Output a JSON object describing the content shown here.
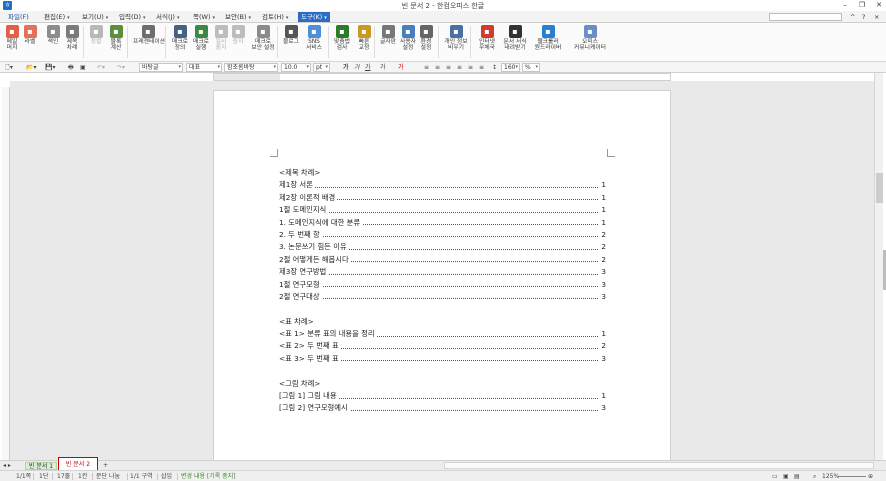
{
  "window": {
    "title": "빈 문서 2 - 한컴오피스 한글",
    "app_icon": "hwp-app-icon",
    "controls": [
      "–",
      "❐",
      "✕"
    ]
  },
  "menubar": {
    "items": [
      {
        "label": "파일(F)"
      },
      {
        "label": "편집(E)"
      },
      {
        "label": "보기(U)"
      },
      {
        "label": "입력(D)"
      },
      {
        "label": "서식(J)"
      },
      {
        "label": "쪽(W)"
      },
      {
        "label": "보안(B)"
      },
      {
        "label": "검토(H)"
      },
      {
        "label": "도구(K)"
      }
    ],
    "active": "도구(K)"
  },
  "ribbon": {
    "buttons": [
      {
        "l1": "메일",
        "l2": "머지",
        "icon": "mail-merge-icon",
        "color": "#e0604a"
      },
      {
        "l1": "라벨",
        "l2": "",
        "icon": "label-icon",
        "color": "#e66f5a"
      },
      {
        "l1": "색인",
        "l2": "",
        "icon": "index-icon",
        "color": "#8c8c8c"
      },
      {
        "l1": "제목",
        "l2": "차례",
        "icon": "toc-icon",
        "color": "#7b7b7b"
      },
      {
        "l1": "정렬",
        "l2": "",
        "icon": "sort-icon",
        "color": "#b8b8b8",
        "dim": true
      },
      {
        "l1": "블록",
        "l2": "계산",
        "icon": "block-calc-icon",
        "color": "#5b8f3a"
      },
      {
        "l1": "프레젠테이션",
        "l2": "",
        "icon": "presentation-icon",
        "color": "#6e6e6e"
      },
      {
        "l1": "매크로",
        "l2": "정의",
        "icon": "macro-define-icon",
        "color": "#4a5f86"
      },
      {
        "l1": "매크로",
        "l2": "실행",
        "icon": "macro-run-icon",
        "color": "#3a8a44"
      },
      {
        "l1": "일시",
        "l2": "중지",
        "icon": "pause-icon",
        "color": "#bdbdbd",
        "dim": true
      },
      {
        "l1": "중지",
        "l2": "",
        "icon": "stop-icon",
        "color": "#bdbdbd",
        "dim": true
      },
      {
        "l1": "매크로",
        "l2": "보안 설정",
        "icon": "macro-security-icon",
        "color": "#8a8a8a"
      },
      {
        "l1": "블로그",
        "l2": "",
        "icon": "blog-icon",
        "color": "#555"
      },
      {
        "l1": "SNS",
        "l2": "서비스",
        "icon": "sns-icon",
        "color": "#4f8ed8"
      },
      {
        "l1": "맞춤법",
        "l2": "검사",
        "icon": "spellcheck-icon",
        "color": "#2d7a2d"
      },
      {
        "l1": "빠른",
        "l2": "교정",
        "icon": "quick-correct-icon",
        "color": "#c99a1b"
      },
      {
        "l1": "글자판",
        "l2": "",
        "icon": "keyboard-icon",
        "color": "#777"
      },
      {
        "l1": "사용자",
        "l2": "설정",
        "icon": "user-settings-icon",
        "color": "#4a7dc0"
      },
      {
        "l1": "환경",
        "l2": "설정",
        "icon": "gear-icon",
        "color": "#666"
      },
      {
        "l1": "개인 정보",
        "l2": "비우기",
        "icon": "privacy-icon",
        "color": "#4a6fa5"
      },
      {
        "l1": "인터넷",
        "l2": "우체국",
        "icon": "internet-post-icon",
        "color": "#d23a2a"
      },
      {
        "l1": "문서 서식",
        "l2": "내려받기",
        "icon": "template-download-icon",
        "color": "#333"
      },
      {
        "l1": "웹크롤러",
        "l2": "원드라이버",
        "icon": "web-crawler-icon",
        "color": "#2a7fd4"
      },
      {
        "l1": "오피스",
        "l2": "커뮤니케이터",
        "icon": "office-communicator-icon",
        "color": "#6a8fc7"
      }
    ]
  },
  "formatbar": {
    "style": "바탕글",
    "font_lang": "대표",
    "font": "함초롬바탕",
    "size": "10.0",
    "unit": "pt",
    "bold": "가",
    "italic": "가",
    "underline": "가",
    "strike": "가",
    "color": "가",
    "line_spacing": "160",
    "pct": "%"
  },
  "document": {
    "toc": [
      {
        "text": "<제목 차례>",
        "page": ""
      },
      {
        "text": "제1장 서론",
        "page": "1"
      },
      {
        "text": "제2장 이론적 배경",
        "page": "1"
      },
      {
        "text": "1절 도메인지식",
        "page": "1"
      },
      {
        "text": "1. 도메인지식에 대한 분류",
        "page": "1"
      },
      {
        "text": "2. 두 번째 항",
        "page": "2"
      },
      {
        "text": "3. 논문쓰기 힘든 이유",
        "page": "2"
      },
      {
        "text": "2절 어떻게든 해봅시다",
        "page": "2"
      },
      {
        "text": "제3장 연구방법",
        "page": "3"
      },
      {
        "text": "1절 연구모형",
        "page": "3"
      },
      {
        "text": "2절 연구대상",
        "page": "3"
      },
      {
        "text": "",
        "page": ""
      },
      {
        "text": "<표 차례>",
        "page": ""
      },
      {
        "text": "<표 1> 분류 표의 내용을 정리",
        "page": "1"
      },
      {
        "text": "<표 2> 두 번째 표",
        "page": "2"
      },
      {
        "text": "<표 3> 두 번째 표",
        "page": "3"
      },
      {
        "text": "",
        "page": ""
      },
      {
        "text": "<그림 차례>",
        "page": ""
      },
      {
        "text": "[그림 1] 그림 내용",
        "page": "1"
      },
      {
        "text": "[그림 2] 연구모형예시",
        "page": "3"
      }
    ]
  },
  "tabs": {
    "items": [
      "빈 문서 1",
      "빈 문서 2"
    ],
    "active": "빈 문서 2",
    "add": "+"
  },
  "statusbar": {
    "page": "1/1쪽",
    "section": "1단",
    "line": "17줄",
    "col": "1칸",
    "break": "문단 나눔",
    "sect": "1/1 구역",
    "mode": "삽입",
    "track": "변경 내용 [기록 중지]",
    "zoom": "125%"
  }
}
